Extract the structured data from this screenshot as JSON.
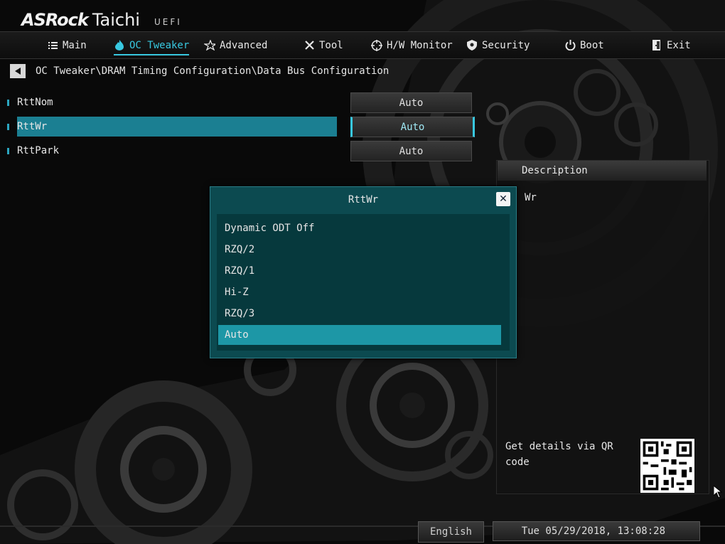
{
  "brand": {
    "name": "ASRock",
    "product": "Taichi",
    "suffix": "UEFI"
  },
  "nav": {
    "tabs": [
      {
        "label": "Main",
        "icon": "list-icon"
      },
      {
        "label": "OC Tweaker",
        "icon": "flame-icon",
        "active": true
      },
      {
        "label": "Advanced",
        "icon": "star-icon"
      },
      {
        "label": "Tool",
        "icon": "tools-icon"
      },
      {
        "label": "H/W Monitor",
        "icon": "crosshair-icon"
      },
      {
        "label": "Security",
        "icon": "shield-icon"
      },
      {
        "label": "Boot",
        "icon": "power-icon"
      },
      {
        "label": "Exit",
        "icon": "exit-icon"
      }
    ]
  },
  "breadcrumb": "OC Tweaker\\DRAM Timing Configuration\\Data Bus Configuration",
  "items": [
    {
      "label": "RttNom",
      "value": "Auto"
    },
    {
      "label": "RttWr",
      "value": "Auto",
      "selected": true
    },
    {
      "label": "RttPark",
      "value": "Auto"
    }
  ],
  "description": {
    "title": "Description",
    "text": "Wr",
    "qr_text": "Get details via QR code"
  },
  "modal": {
    "title": "RttWr",
    "options": [
      "Dynamic ODT Off",
      "RZQ/2",
      "RZQ/1",
      "Hi-Z",
      "RZQ/3",
      "Auto"
    ],
    "selected_option": "Auto"
  },
  "footer": {
    "language": "English",
    "datetime": "Tue 05/29/2018, 13:08:28"
  },
  "colors": {
    "accent": "#38c8e0",
    "selection": "#1b7f92",
    "modal_bg": "#0c4a50",
    "option_highlight": "#1d97a6"
  }
}
